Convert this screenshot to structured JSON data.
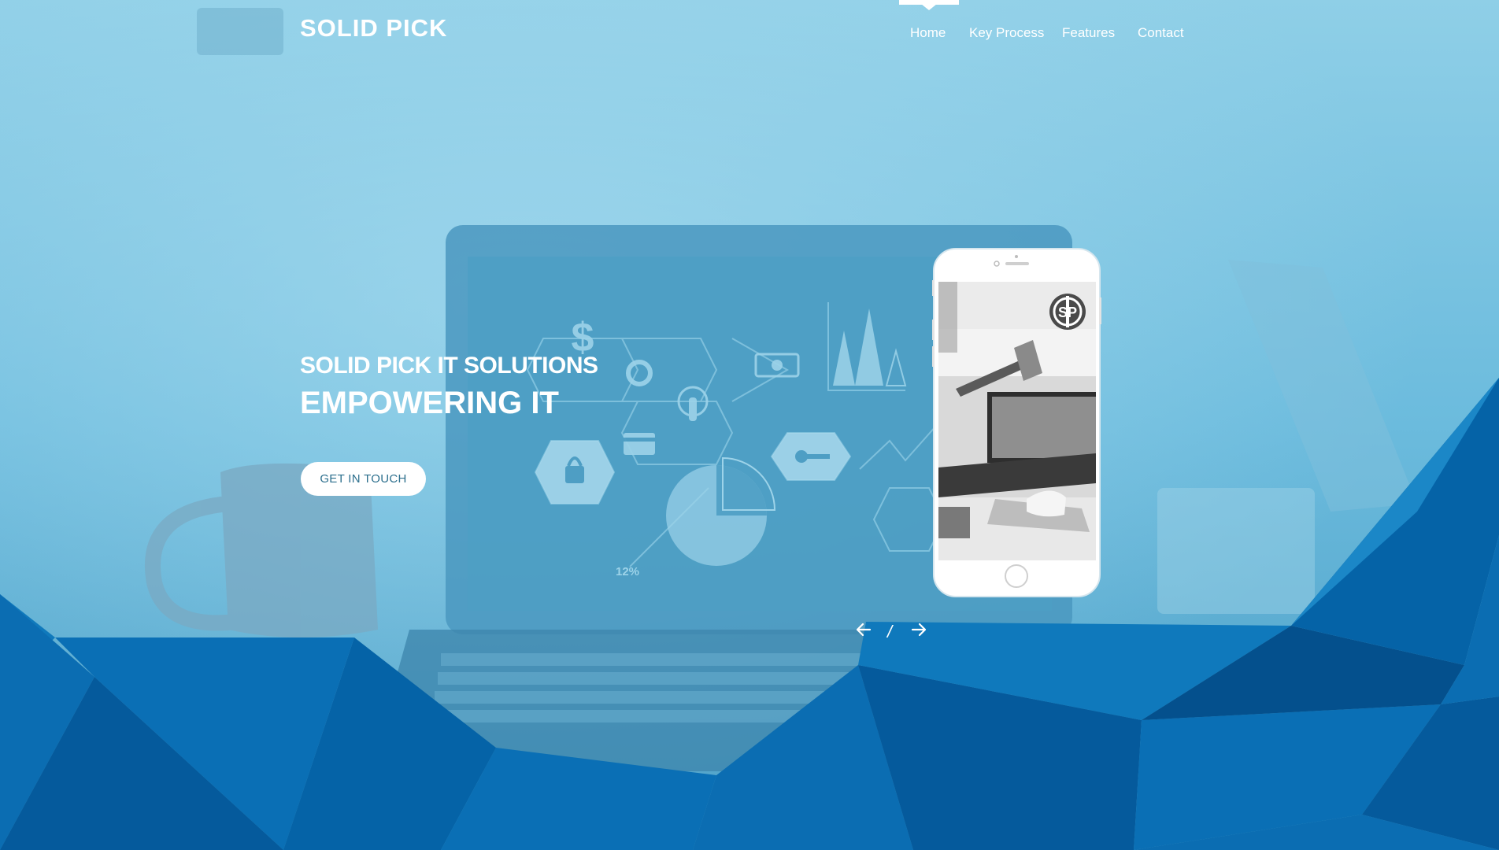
{
  "brand": {
    "logo": "SOLID PICK"
  },
  "nav": {
    "items": [
      {
        "label": "Home",
        "active": true
      },
      {
        "label": "Key Process"
      },
      {
        "label": "Features"
      },
      {
        "label": "Contact"
      }
    ]
  },
  "hero": {
    "kicker": "SOLID PICK IT SOLUTIONS",
    "title": "EMPOWERING IT",
    "cta_label": "GET IN TOUCH",
    "chart_label": "12%"
  },
  "slider": {
    "separator": "/"
  },
  "colors": {
    "sky": "#5fb3d6",
    "accent": "#0a6fb5",
    "deep_blue": "#055a9c",
    "text": "#ffffff",
    "cta_text": "#2c6f8d"
  },
  "icons": [
    "dollar-icon",
    "refresh-icon",
    "padlock-icon",
    "hand-pointer-icon",
    "credit-card-icon",
    "banknote-icon",
    "key-icon",
    "pie-chart-icon",
    "bar-chart-icon",
    "arrow-left-icon",
    "arrow-right-icon",
    "sp-logo-icon"
  ]
}
